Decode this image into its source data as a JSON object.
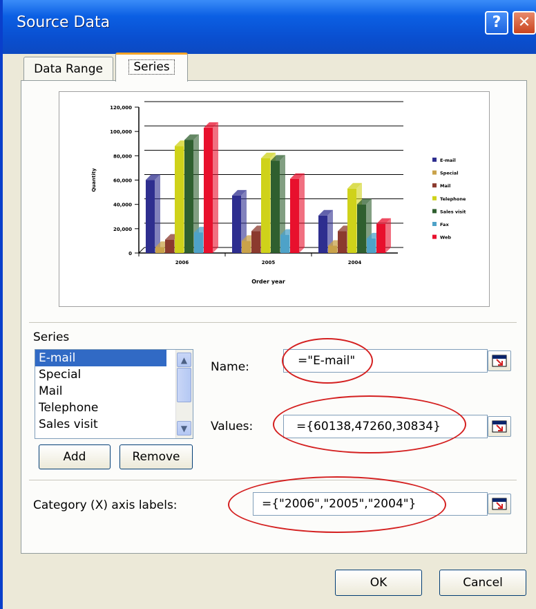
{
  "window": {
    "title": "Source Data"
  },
  "tabs": [
    {
      "label": "Data Range"
    },
    {
      "label": "Series"
    }
  ],
  "chart_data": {
    "type": "bar",
    "title": "",
    "xlabel": "Order year",
    "ylabel": "Quantity",
    "categories": [
      "2006",
      "2005",
      "2004"
    ],
    "ylim": [
      0,
      120000
    ],
    "yticks": [
      "0",
      "20,000",
      "40,000",
      "60,000",
      "80,000",
      "100,000",
      "120,000"
    ],
    "legend_position": "right",
    "series": [
      {
        "name": "E-mail",
        "color": "#2e2e8f",
        "values": [
          60138,
          47260,
          30834
        ]
      },
      {
        "name": "Special",
        "color": "#c9a24a",
        "values": [
          5000,
          10000,
          6000
        ]
      },
      {
        "name": "Mail",
        "color": "#8b3a2e",
        "values": [
          11000,
          18000,
          18000
        ]
      },
      {
        "name": "Telephone",
        "color": "#cfd21a",
        "values": [
          88000,
          78000,
          53000
        ]
      },
      {
        "name": "Sales visit",
        "color": "#2f5f2f",
        "values": [
          93000,
          76000,
          40000
        ]
      },
      {
        "name": "Fax",
        "color": "#4ea2c8",
        "values": [
          17000,
          15000,
          12000
        ]
      },
      {
        "name": "Web",
        "color": "#e8102d",
        "values": [
          103000,
          61000,
          24000
        ]
      }
    ]
  },
  "series_section": {
    "label": "Series",
    "items": [
      "E-mail",
      "Special",
      "Mail",
      "Telephone",
      "Sales visit"
    ],
    "selected": "E-mail",
    "add_label": "Add",
    "remove_label": "Remove"
  },
  "fields": {
    "name_label": "Name:",
    "name_value": "=\"E-mail\"",
    "values_label": "Values:",
    "values_value": "={60138,47260,30834}",
    "category_label": "Category (X) axis labels:",
    "category_value": "={\"2006\",\"2005\",\"2004\"}"
  },
  "buttons": {
    "ok": "OK",
    "cancel": "Cancel"
  },
  "annotation_color": "#d42020"
}
